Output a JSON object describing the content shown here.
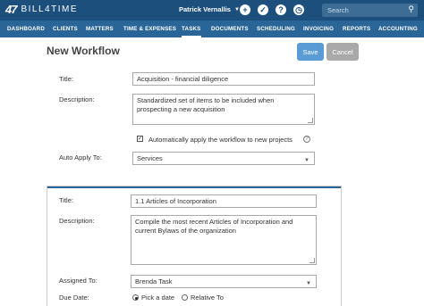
{
  "app": {
    "logo_mark": "47",
    "logo_text": "BILL4TIME"
  },
  "topbar": {
    "user_name": "Patrick Vernallis",
    "search_placeholder": "Search"
  },
  "nav": {
    "items": [
      "DASHBOARD",
      "CLIENTS",
      "MATTERS",
      "TIME & EXPENSES",
      "TASKS",
      "DOCUMENTS",
      "SCHEDULING",
      "INVOICING",
      "REPORTS",
      "ACCOUNTING"
    ],
    "active": "TASKS"
  },
  "page": {
    "title": "New Workflow",
    "save_label": "Save",
    "cancel_label": "Cancel"
  },
  "workflow": {
    "title_label": "Title:",
    "title_value": "Acquisition - financial diligence",
    "description_label": "Description:",
    "description_value": "Standardized set of items to be included when prospecting a new acquisition",
    "auto_apply_checkbox_label": "Automatically apply the workflow to new projects",
    "auto_apply_checked": true,
    "auto_apply_to_label": "Auto Apply To:",
    "auto_apply_to_value": "Services"
  },
  "task": {
    "title_label": "Title:",
    "title_value": "1.1 Articles of Incorporation",
    "description_label": "Description:",
    "description_value": "Compile the most recent Articles of Incorporation and current  Bylaws of the organization",
    "assigned_to_label": "Assigned To:",
    "assigned_to_value": "Brenda Task",
    "due_date_label": "Due Date:",
    "due_option_pick": "Pick a date",
    "due_option_relative": "Relative To",
    "due_selected": "Pick a date"
  },
  "colors": {
    "topbar": "#1c4f7c",
    "navbar": "#2a6597",
    "save_button": "#5b9bd5",
    "cancel_button": "#a9a9a9"
  }
}
